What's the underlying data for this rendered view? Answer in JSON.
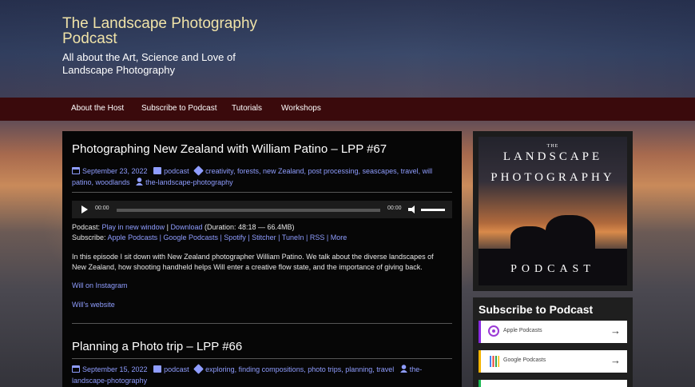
{
  "site": {
    "title": "The Landscape Photography Podcast",
    "description": "All about the Art, Science and Love of Landscape Photography"
  },
  "nav": [
    "About the Host",
    "Subscribe to Podcast",
    "Tutorials",
    "Workshops"
  ],
  "post1": {
    "title": "Photographing New Zealand with William Patino – LPP #67",
    "date": "September 23, 2022",
    "category": "podcast",
    "tags": "creativity, forests, new Zealand, post processing, seascapes, travel, will patino, woodlands",
    "author": "the-landscape-photography",
    "player": {
      "current": "00:00",
      "duration": "00:00"
    },
    "podcast_label": "Podcast:",
    "play_new_window": "Play in new window",
    "download": "Download",
    "duration_text": "(Duration: 48:18 — 66.4MB)",
    "subscribe_label": "Subscribe:",
    "subscribe_links": "Apple Podcasts | Google Podcasts | Spotify | Stitcher | TuneIn | RSS | More",
    "body": "In this episode I sit down with New Zealand photographer William Patino.  We talk about the diverse landscapes of New Zealand, how shooting handheld helps Will enter a creative flow state, and the importance of giving back.",
    "link1": "Will on Instagram",
    "link2": "Will's website"
  },
  "post2": {
    "title": "Planning a Photo trip – LPP #66",
    "date": "September 15, 2022",
    "category": "podcast",
    "tags": "exploring, finding compositions, photo trips, planning, travel",
    "author": "the-landscape-photography"
  },
  "sidebar": {
    "art": {
      "the": "THE",
      "line1": "LANDSCAPE",
      "line2": "PHOTOGRAPHY",
      "line3": "PODCAST"
    },
    "subscribe_title": "Subscribe to Podcast",
    "buttons": [
      "Apple Podcasts",
      "Google Podcasts"
    ]
  },
  "colors": {
    "nav_bg": "#3a0a0c",
    "title": "#f0e3a8",
    "link": "#8f9dff",
    "content_bg": "#060606"
  }
}
